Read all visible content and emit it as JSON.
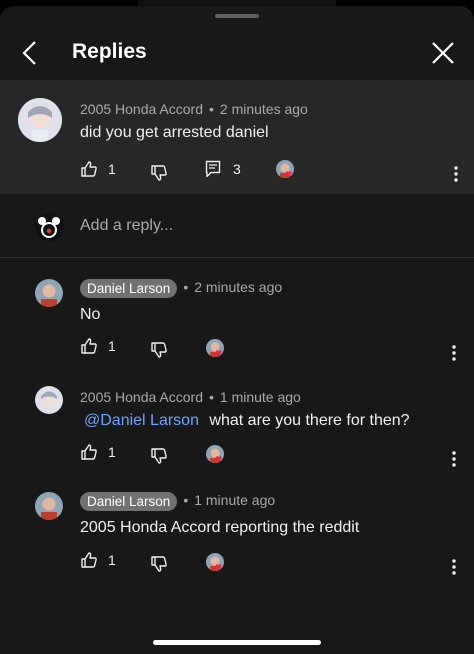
{
  "header": {
    "title": "Replies"
  },
  "parent_comment": {
    "author": "2005 Honda Accord",
    "time": "2 minutes ago",
    "text": "did you get arrested daniel",
    "likes": "1",
    "replies": "3"
  },
  "reply_box": {
    "placeholder": "Add a reply..."
  },
  "replies": [
    {
      "author": "Daniel Larson",
      "time": "2 minutes ago",
      "text": "No",
      "likes": "1"
    },
    {
      "author": "2005 Honda Accord",
      "time": "1 minute ago",
      "mention": "@Daniel Larson",
      "text": "what are you there for then?",
      "likes": "1"
    },
    {
      "author": "Daniel Larson",
      "time": "1 minute ago",
      "text": "2005 Honda Accord reporting the reddit",
      "likes": "1"
    }
  ],
  "colors": {
    "background": "#181818",
    "highlight": "#272727",
    "link": "#6aa3ff",
    "heart": "#ff1d3d"
  }
}
